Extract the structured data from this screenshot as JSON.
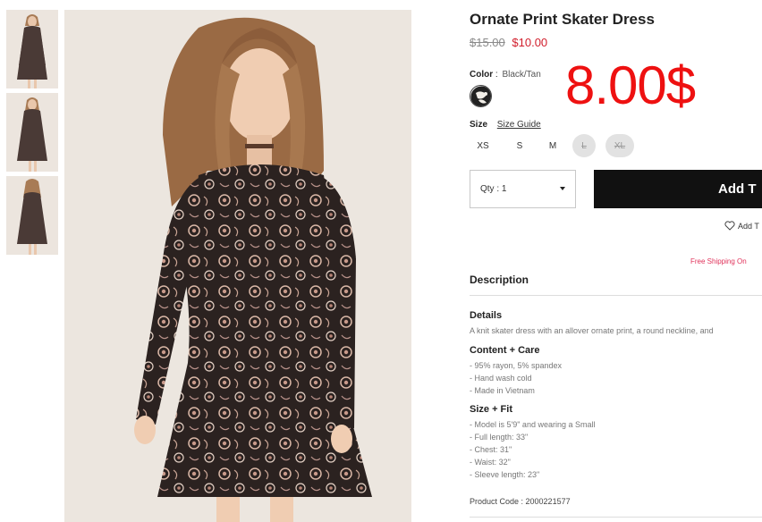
{
  "product": {
    "title": "Ornate Print Skater Dress",
    "old_price": "$15.00",
    "new_price": "$10.00",
    "overlay_price": "8.00$"
  },
  "color": {
    "label": "Color",
    "separator": ":",
    "value": "Black/Tan"
  },
  "sizes": {
    "label": "Size",
    "guide_link": "Size Guide",
    "options": [
      {
        "label": "XS",
        "available": true
      },
      {
        "label": "S",
        "available": true
      },
      {
        "label": "M",
        "available": true
      },
      {
        "label": "L",
        "available": false
      },
      {
        "label": "XL",
        "available": false
      }
    ]
  },
  "quantity": {
    "label": "Qty : 1"
  },
  "add_to_bag": {
    "label": "Add T"
  },
  "wishlist": {
    "label": "Add T",
    "icon": "heart-outline-icon"
  },
  "free_shipping": "Free Shipping On",
  "description": {
    "heading": "Description",
    "details": {
      "title": "Details",
      "text": "A knit skater dress with an allover ornate print, a round neckline, and"
    },
    "content_care": {
      "title": "Content + Care",
      "items": [
        "- 95% rayon, 5% spandex",
        "- Hand wash cold",
        "- Made in Vietnam"
      ]
    },
    "size_fit": {
      "title": "Size + Fit",
      "items": [
        "- Model is 5'9\" and wearing a Small",
        "- Full length: 33\"",
        "- Chest: 31\"",
        "- Waist: 32\"",
        "- Sleeve length: 23\""
      ]
    },
    "product_code": "Product Code : 2000221577"
  },
  "colors": {
    "price_sale": "#d11d2b",
    "overlay": "#ee1111",
    "button_bg": "#111111",
    "free_shipping": "#e0325a",
    "unavailable_size_bg": "#e2e2e2"
  }
}
